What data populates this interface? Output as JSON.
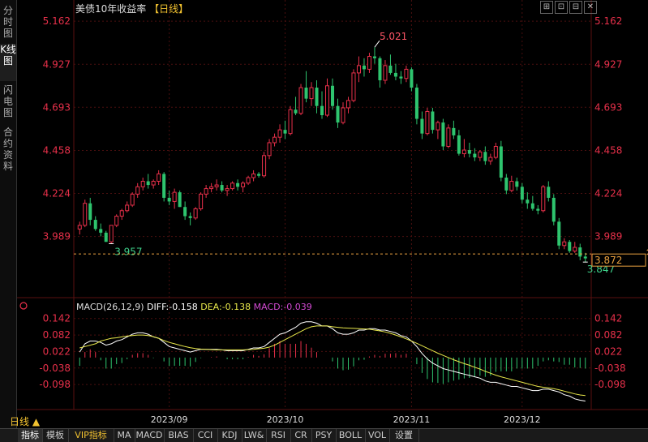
{
  "sidebar": {
    "tabs": [
      "分时图",
      "K线图",
      "闪电图",
      "合约资料"
    ],
    "active": 1
  },
  "header": {
    "title": "美债10年收益率",
    "timeframe": "【日线】",
    "tools": [
      "⊞",
      "⊡",
      "⊟",
      "✕"
    ]
  },
  "price_chart": {
    "y_ticks": [
      "5.162",
      "4.927",
      "4.693",
      "4.458",
      "4.224",
      "3.989"
    ],
    "high_label": "5.021",
    "low_label": "3.957",
    "last_low_label": "3.847",
    "current_price": "3.872"
  },
  "macd": {
    "params": "MACD(26,12,9)",
    "diff_label": "DIFF:-0.158",
    "dea_label": "DEA:-0.138",
    "macd_label": "MACD:-0.039",
    "y_ticks": [
      "0.142",
      "0.082",
      "0.022",
      "-0.038",
      "-0.098"
    ]
  },
  "x_axis": {
    "labels": [
      "2023/09",
      "2023/10",
      "2023/11",
      "2023/12"
    ]
  },
  "period_selector": "日线 ▲",
  "bottom_tabs": [
    "指标",
    "模板",
    "VIP指标",
    "MA",
    "MACD",
    "BIAS",
    "CCI",
    "KDJ",
    "LW&",
    "RSI",
    "CR",
    "PSY",
    "BOLL",
    "VOL",
    "设置"
  ],
  "colors": {
    "up": "#e8304a",
    "down": "#2ec46e",
    "diff": "#ffffff",
    "dea": "#e8e84a",
    "macd_text": "#d24ad2",
    "axis_text": "#e8304a",
    "grid": "#4a0f0f"
  },
  "chart_data": {
    "type": "candlestick",
    "title": "美债10年收益率",
    "ylim": [
      3.78,
      5.18
    ],
    "x_labels": [
      "2023/09",
      "2023/10",
      "2023/11",
      "2023/12"
    ],
    "ohlc": [
      [
        4.03,
        4.07,
        4.0,
        4.05
      ],
      [
        4.05,
        4.19,
        4.04,
        4.17
      ],
      [
        4.17,
        4.2,
        4.05,
        4.08
      ],
      [
        4.08,
        4.1,
        4.02,
        4.03
      ],
      [
        4.03,
        4.06,
        3.99,
        4.01
      ],
      [
        4.01,
        4.02,
        3.96,
        3.96
      ],
      [
        3.96,
        4.05,
        3.95,
        4.05
      ],
      [
        4.05,
        4.11,
        4.04,
        4.1
      ],
      [
        4.1,
        4.14,
        4.08,
        4.13
      ],
      [
        4.13,
        4.18,
        4.12,
        4.16
      ],
      [
        4.16,
        4.23,
        4.15,
        4.22
      ],
      [
        4.22,
        4.28,
        4.2,
        4.26
      ],
      [
        4.26,
        4.31,
        4.24,
        4.29
      ],
      [
        4.29,
        4.33,
        4.25,
        4.27
      ],
      [
        4.27,
        4.3,
        4.25,
        4.29
      ],
      [
        4.29,
        4.35,
        4.27,
        4.33
      ],
      [
        4.33,
        4.34,
        4.18,
        4.2
      ],
      [
        4.2,
        4.24,
        4.16,
        4.18
      ],
      [
        4.18,
        4.25,
        4.14,
        4.23
      ],
      [
        4.23,
        4.24,
        4.15,
        4.15
      ],
      [
        4.15,
        4.18,
        4.08,
        4.1
      ],
      [
        4.1,
        4.12,
        4.05,
        4.09
      ],
      [
        4.09,
        4.15,
        4.08,
        4.14
      ],
      [
        4.14,
        4.23,
        4.13,
        4.22
      ],
      [
        4.22,
        4.27,
        4.2,
        4.25
      ],
      [
        4.25,
        4.28,
        4.23,
        4.26
      ],
      [
        4.26,
        4.3,
        4.24,
        4.27
      ],
      [
        4.27,
        4.29,
        4.23,
        4.24
      ],
      [
        4.24,
        4.27,
        4.21,
        4.25
      ],
      [
        4.25,
        4.29,
        4.24,
        4.28
      ],
      [
        4.28,
        4.3,
        4.24,
        4.26
      ],
      [
        4.26,
        4.29,
        4.23,
        4.28
      ],
      [
        4.28,
        4.32,
        4.27,
        4.31
      ],
      [
        4.31,
        4.35,
        4.29,
        4.33
      ],
      [
        4.33,
        4.34,
        4.31,
        4.32
      ],
      [
        4.32,
        4.45,
        4.31,
        4.43
      ],
      [
        4.43,
        4.52,
        4.41,
        4.5
      ],
      [
        4.5,
        4.55,
        4.48,
        4.53
      ],
      [
        4.53,
        4.6,
        4.5,
        4.57
      ],
      [
        4.57,
        4.62,
        4.52,
        4.55
      ],
      [
        4.55,
        4.7,
        4.54,
        4.68
      ],
      [
        4.68,
        4.75,
        4.65,
        4.66
      ],
      [
        4.66,
        4.82,
        4.65,
        4.8
      ],
      [
        4.8,
        4.89,
        4.72,
        4.74
      ],
      [
        4.74,
        4.83,
        4.7,
        4.8
      ],
      [
        4.8,
        4.84,
        4.66,
        4.7
      ],
      [
        4.7,
        4.78,
        4.63,
        4.65
      ],
      [
        4.65,
        4.85,
        4.64,
        4.81
      ],
      [
        4.81,
        4.85,
        4.68,
        4.7
      ],
      [
        4.7,
        4.74,
        4.58,
        4.61
      ],
      [
        4.61,
        4.72,
        4.6,
        4.69
      ],
      [
        4.69,
        4.75,
        4.66,
        4.73
      ],
      [
        4.73,
        4.9,
        4.72,
        4.88
      ],
      [
        4.88,
        4.97,
        4.83,
        4.92
      ],
      [
        4.92,
        4.96,
        4.86,
        4.9
      ],
      [
        4.9,
        4.99,
        4.88,
        4.97
      ],
      [
        4.97,
        5.02,
        4.93,
        4.96
      ],
      [
        4.96,
        4.97,
        4.8,
        4.84
      ],
      [
        4.84,
        4.95,
        4.82,
        4.92
      ],
      [
        4.92,
        4.98,
        4.87,
        4.88
      ],
      [
        4.88,
        4.93,
        4.84,
        4.86
      ],
      [
        4.86,
        4.89,
        4.82,
        4.85
      ],
      [
        4.85,
        4.92,
        4.83,
        4.9
      ],
      [
        4.9,
        4.91,
        4.78,
        4.8
      ],
      [
        4.8,
        4.82,
        4.6,
        4.63
      ],
      [
        4.63,
        4.67,
        4.52,
        4.55
      ],
      [
        4.55,
        4.69,
        4.54,
        4.67
      ],
      [
        4.67,
        4.69,
        4.55,
        4.57
      ],
      [
        4.57,
        4.62,
        4.52,
        4.61
      ],
      [
        4.61,
        4.63,
        4.46,
        4.48
      ],
      [
        4.48,
        4.6,
        4.47,
        4.58
      ],
      [
        4.58,
        4.62,
        4.52,
        4.54
      ],
      [
        4.54,
        4.57,
        4.43,
        4.44
      ],
      [
        4.44,
        4.52,
        4.42,
        4.46
      ],
      [
        4.46,
        4.5,
        4.42,
        4.44
      ],
      [
        4.44,
        4.47,
        4.4,
        4.42
      ],
      [
        4.42,
        4.46,
        4.4,
        4.45
      ],
      [
        4.45,
        4.48,
        4.38,
        4.4
      ],
      [
        4.4,
        4.44,
        4.38,
        4.42
      ],
      [
        4.42,
        4.5,
        4.41,
        4.48
      ],
      [
        4.48,
        4.51,
        4.29,
        4.31
      ],
      [
        4.31,
        4.33,
        4.22,
        4.24
      ],
      [
        4.24,
        4.32,
        4.23,
        4.29
      ],
      [
        4.29,
        4.31,
        4.24,
        4.26
      ],
      [
        4.26,
        4.28,
        4.17,
        4.19
      ],
      [
        4.19,
        4.23,
        4.14,
        4.17
      ],
      [
        4.17,
        4.21,
        4.13,
        4.14
      ],
      [
        4.14,
        4.16,
        4.11,
        4.13
      ],
      [
        4.13,
        4.27,
        4.12,
        4.26
      ],
      [
        4.26,
        4.29,
        4.18,
        4.2
      ],
      [
        4.2,
        4.22,
        4.05,
        4.07
      ],
      [
        4.07,
        4.09,
        3.92,
        3.94
      ],
      [
        3.94,
        3.98,
        3.92,
        3.96
      ],
      [
        3.96,
        3.97,
        3.9,
        3.91
      ],
      [
        3.91,
        3.96,
        3.9,
        3.93
      ],
      [
        3.93,
        3.95,
        3.86,
        3.88
      ],
      [
        3.88,
        3.9,
        3.85,
        3.87
      ]
    ],
    "macd": {
      "diff": [
        0.02,
        0.05,
        0.06,
        0.06,
        0.055,
        0.045,
        0.05,
        0.06,
        0.065,
        0.075,
        0.085,
        0.09,
        0.09,
        0.085,
        0.075,
        0.07,
        0.055,
        0.04,
        0.035,
        0.03,
        0.025,
        0.02,
        0.025,
        0.03,
        0.03,
        0.03,
        0.03,
        0.028,
        0.025,
        0.025,
        0.025,
        0.025,
        0.03,
        0.035,
        0.035,
        0.04,
        0.055,
        0.07,
        0.085,
        0.09,
        0.1,
        0.11,
        0.125,
        0.13,
        0.13,
        0.125,
        0.115,
        0.115,
        0.105,
        0.09,
        0.085,
        0.085,
        0.09,
        0.1,
        0.1,
        0.105,
        0.105,
        0.1,
        0.1,
        0.095,
        0.09,
        0.08,
        0.075,
        0.06,
        0.04,
        0.015,
        -0.005,
        -0.02,
        -0.03,
        -0.04,
        -0.045,
        -0.05,
        -0.055,
        -0.06,
        -0.065,
        -0.07,
        -0.075,
        -0.085,
        -0.09,
        -0.09,
        -0.095,
        -0.1,
        -0.105,
        -0.105,
        -0.11,
        -0.115,
        -0.12,
        -0.12,
        -0.115,
        -0.115,
        -0.12,
        -0.125,
        -0.135,
        -0.14,
        -0.15,
        -0.155,
        -0.158
      ],
      "dea": [
        0.035,
        0.04,
        0.045,
        0.05,
        0.06,
        0.065,
        0.07,
        0.072,
        0.075,
        0.078,
        0.08,
        0.082,
        0.082,
        0.08,
        0.076,
        0.07,
        0.062,
        0.055,
        0.05,
        0.045,
        0.04,
        0.036,
        0.033,
        0.031,
        0.03,
        0.029,
        0.028,
        0.028,
        0.028,
        0.028,
        0.028,
        0.028,
        0.029,
        0.03,
        0.032,
        0.034,
        0.038,
        0.045,
        0.055,
        0.065,
        0.075,
        0.085,
        0.095,
        0.105,
        0.112,
        0.115,
        0.115,
        0.115,
        0.112,
        0.11,
        0.108,
        0.107,
        0.106,
        0.105,
        0.104,
        0.103,
        0.1,
        0.097,
        0.093,
        0.088,
        0.082,
        0.075,
        0.068,
        0.06,
        0.052,
        0.043,
        0.034,
        0.025,
        0.016,
        0.008,
        0,
        -0.008,
        -0.015,
        -0.022,
        -0.028,
        -0.035,
        -0.042,
        -0.05,
        -0.057,
        -0.064,
        -0.07,
        -0.075,
        -0.08,
        -0.085,
        -0.09,
        -0.095,
        -0.1,
        -0.105,
        -0.108,
        -0.11,
        -0.113,
        -0.117,
        -0.122,
        -0.127,
        -0.132,
        -0.136,
        -0.138
      ]
    }
  }
}
